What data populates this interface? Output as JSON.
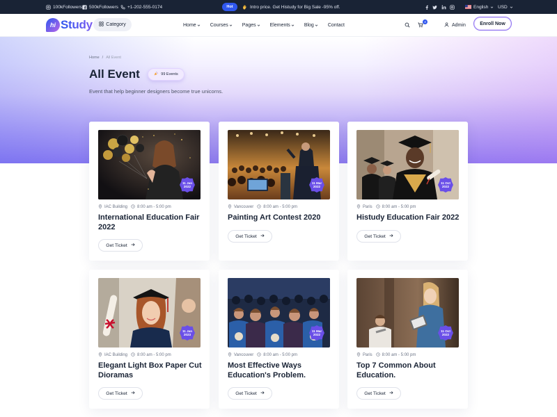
{
  "topbar": {
    "instagram": "100kFollowers",
    "facebook": "500kFollowers",
    "phone": "+1-202-555-0174",
    "hot_label": "Hot",
    "promo": "Intro price. Get Histudy for Big Sale -95% off.",
    "language": "English",
    "currency": "USD",
    "social_icons": [
      "facebook-icon",
      "twitter-icon",
      "linkedin-icon",
      "instagram-icon"
    ]
  },
  "header": {
    "logo_mark": "hi",
    "logo_text": "Study",
    "category_label": "Category",
    "nav": [
      "Home",
      "Courses",
      "Pages",
      "Elements",
      "Blog",
      "Contact"
    ],
    "cart_count": "4",
    "admin_label": "Admin",
    "enroll_label": "Enroll Now"
  },
  "hero": {
    "breadcrumb_home": "Home",
    "breadcrumb_sep": "/",
    "breadcrumb_current": "All Event",
    "title": "All Event",
    "count_label": "99 Events",
    "description": "Event that help beginner designers become true unicorns."
  },
  "events": [
    {
      "location": "IAC Building",
      "time": "8:00 am - 5:00 pm",
      "title": "International Education Fair 2022",
      "date_day": "11 Jan",
      "date_year": "2022",
      "ticket_label": "Get Ticket"
    },
    {
      "location": "Vancouver",
      "time": "8:00 am - 5:00 pm",
      "title": "Painting Art Contest 2020",
      "date_day": "11 Mar",
      "date_year": "2022",
      "ticket_label": "Get Ticket"
    },
    {
      "location": "Paris",
      "time": "8:00 am - 5:00 pm",
      "title": "Histudy Education Fair 2022",
      "date_day": "11 Oct",
      "date_year": "2022",
      "ticket_label": "Get Ticket"
    },
    {
      "location": "IAC Building",
      "time": "8:00 am - 5:00 pm",
      "title": "Elegant Light Box Paper Cut Dioramas",
      "date_day": "11 Jan",
      "date_year": "2023",
      "ticket_label": "Get Ticket"
    },
    {
      "location": "Vancouver",
      "time": "8:00 am - 5:00 pm",
      "title": "Most Effective Ways Education's Problem.",
      "date_day": "11 Mar",
      "date_year": "2022",
      "ticket_label": "Get Ticket"
    },
    {
      "location": "Paris",
      "time": "8:00 am - 5:00 pm",
      "title": "Top 7 Common About Education.",
      "date_day": "11 Oct",
      "date_year": "2022",
      "ticket_label": "Get Ticket"
    }
  ],
  "colors": {
    "primary": "#2f57ef",
    "secondary": "#b966e7",
    "heading": "#192335",
    "badge": "#6a4fe8",
    "topbar_bg": "#192335"
  }
}
